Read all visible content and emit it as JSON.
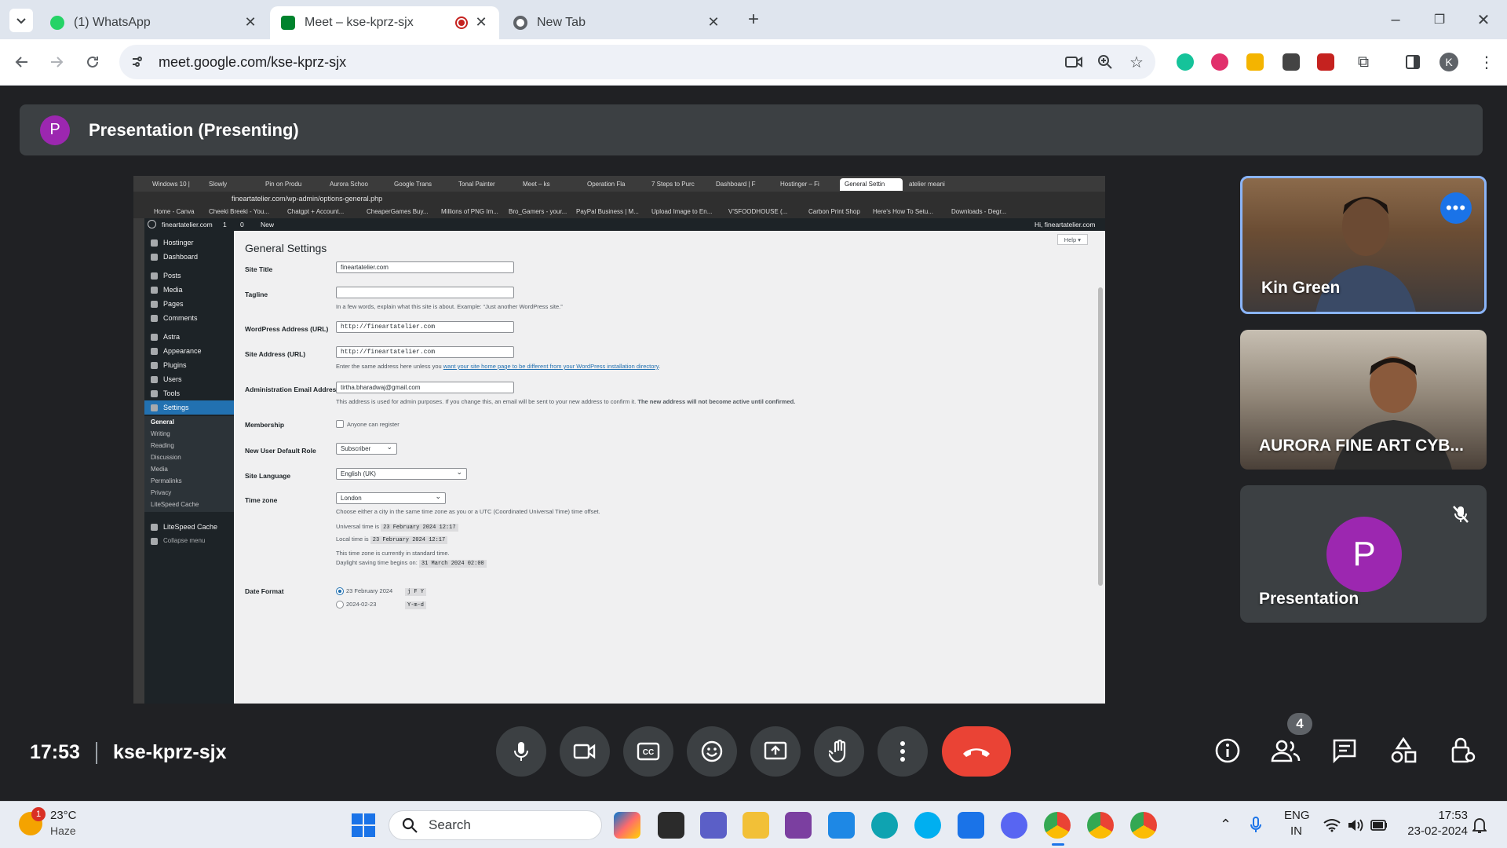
{
  "browser": {
    "tabs": [
      {
        "title": "(1) WhatsApp",
        "icon": "whatsapp-icon",
        "color": "#25d366"
      },
      {
        "title": "Meet – kse-kprz-sjx",
        "icon": "google-meet-icon",
        "color": "#00832d",
        "active": true,
        "recording": true
      },
      {
        "title": "New Tab",
        "icon": "chrome-icon",
        "color": "#5f6368"
      }
    ],
    "url": "meet.google.com/kse-kprz-sjx"
  },
  "meet": {
    "presentation_bar": {
      "avatar_letter": "P",
      "title": "Presentation (Presenting)"
    },
    "participants": [
      {
        "name": "Kin Green",
        "active_speaker": true
      },
      {
        "name": "AURORA FINE ART CYB..."
      },
      {
        "name": "Presentation",
        "avatar_letter": "P",
        "muted": true
      }
    ],
    "time": "17:53",
    "meeting_code": "kse-kprz-sjx",
    "people_count": "4",
    "accent": "#1a73e8",
    "end_call_color": "#ea4335"
  },
  "shared_screen": {
    "tabs": [
      "Windows 10 |",
      "Slowly",
      "Pin on Produ",
      "Aurora Schoo",
      "Google Trans",
      "Tonal Painter",
      "Meet – ks",
      "Operation Fla",
      "7 Steps to Purc",
      "Dashboard | F",
      "Hostinger – Fi",
      "General Settin",
      "atelier meani"
    ],
    "address": "fineartatelier.com/wp-admin/options-general.php",
    "bookmarks": [
      "Home - Canva",
      "Cheeki Breeki - You...",
      "Chatgpt + Account...",
      "CheaperGames Buy...",
      "Millions of PNG Im...",
      "Bro_Gamers - your...",
      "PayPal Business | M...",
      "Upload Image to En...",
      "V'SFOODHOUSE (...",
      "Carbon Print Shop",
      "Here's How To Setu...",
      "Downloads - Degr..."
    ],
    "adminbar": {
      "site": "fineartatelier.com",
      "updates": "1",
      "comments": "0",
      "new": "New",
      "greeting": "Hi, fineartatelier.com"
    },
    "menu": [
      "Hostinger",
      "Dashboard",
      "Posts",
      "Media",
      "Pages",
      "Comments",
      "Astra",
      "Appearance",
      "Plugins",
      "Users",
      "Tools",
      "Settings"
    ],
    "submenu": [
      "General",
      "Writing",
      "Reading",
      "Discussion",
      "Media",
      "Permalinks",
      "Privacy",
      "LiteSpeed Cache"
    ],
    "menu_bottom": [
      "LiteSpeed Cache",
      "Collapse menu"
    ],
    "help": "Help ▾",
    "page_title": "General Settings",
    "fields": {
      "site_title_label": "Site Title",
      "site_title_value": "fineartatelier.com",
      "tagline_label": "Tagline",
      "tagline_value": "",
      "tagline_hint": "In a few words, explain what this site is about. Example: “Just another WordPress site.”",
      "wp_address_label": "WordPress Address (URL)",
      "wp_address_value": "http://fineartatelier.com",
      "site_address_label": "Site Address (URL)",
      "site_address_value": "http://fineartatelier.com",
      "site_address_hint": "Enter the same address here unless you",
      "site_address_link": "want your site home page to be different from your WordPress installation directory",
      "email_label": "Administration Email Address",
      "email_value": "tirtha.bharadwaj@gmail.com",
      "email_hint": "This address is used for admin purposes. If you change this, an email will be sent to your new address to confirm it.",
      "email_hint_bold": "The new address will not become active until confirmed.",
      "membership_label": "Membership",
      "membership_checkbox": "Anyone can register",
      "role_label": "New User Default Role",
      "role_value": "Subscriber",
      "language_label": "Site Language",
      "language_value": "English (UK)",
      "timezone_label": "Time zone",
      "timezone_value": "London",
      "timezone_hint": "Choose either a city in the same time zone as you or a UTC (Coordinated Universal Time) time offset.",
      "universal_time_label": "Universal time is",
      "universal_time": "23 February 2024 12:17",
      "local_time_label": "Local time is",
      "local_time": "23 February 2024 12:17",
      "standard_time_note": "This time zone is currently in standard time.",
      "dst_label": "Daylight saving time begins on:",
      "dst_value": "31 March 2024 02:00",
      "date_format_label": "Date Format",
      "date_opt1": "23 February 2024",
      "date_opt1_code": "j F Y",
      "date_opt2": "2024-02-23",
      "date_opt2_code": "Y-m-d"
    }
  },
  "taskbar": {
    "weather_temp": "23°C",
    "weather_desc": "Haze",
    "weather_badge": "1",
    "search_placeholder": "Search",
    "lang_1": "ENG",
    "lang_2": "IN",
    "clock_time": "17:53",
    "clock_date": "23-02-2024"
  }
}
